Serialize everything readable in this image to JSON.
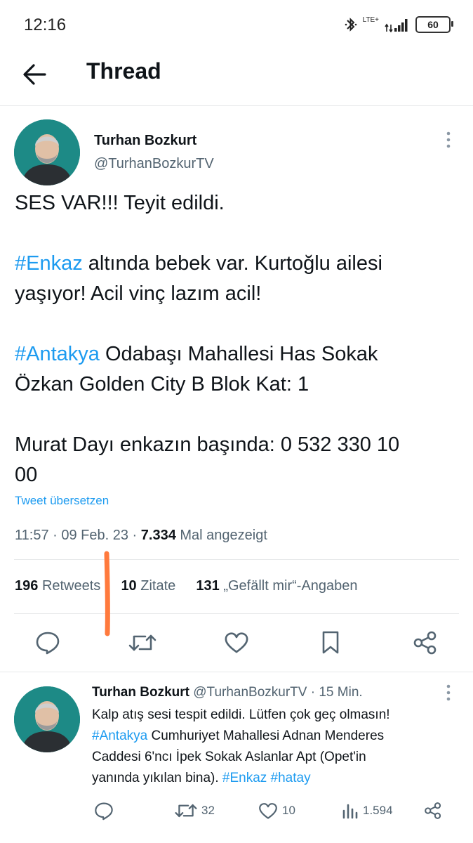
{
  "status_bar": {
    "time": "12:16",
    "network_label": "LTE+",
    "battery_level": "60"
  },
  "nav": {
    "title": "Thread"
  },
  "main_tweet": {
    "author_name": "Turhan Bozkurt",
    "author_handle": "@TurhanBozkurTV",
    "line1": "SES VAR!!! Teyit edildi.",
    "para2_hashtag": "#Enkaz",
    "para2_text_a": " altında bebek var. Kurtoğlu ailesi",
    "para2_text_b": "yaşıyor! Acil vinç lazım acil!",
    "para3_hashtag": "#Antakya",
    "para3_text_a": " Odabaşı Mahallesi Has Sokak",
    "para3_text_b": "Özkan Golden City B Blok Kat: 1",
    "para4_text_a": "Murat Dayı enkazın başında: 0 532 330 10",
    "para4_text_b": "00",
    "translate_label": "Tweet übersetzen",
    "time": "11:57",
    "date": "09 Feb. 23",
    "views_count": "7.334",
    "views_label": "Mal angezeigt",
    "retweets_count": "196",
    "retweets_label": "Retweets",
    "quotes_count": "10",
    "quotes_label": "Zitate",
    "likes_count": "131",
    "likes_label": "„Gefällt mir“-Angaben"
  },
  "reply_tweet": {
    "author_name": "Turhan Bozkurt",
    "author_handle": "@TurhanBozkurTV",
    "time_ago": "15 Min.",
    "text_a": "Kalp atış sesi tespit edildi. Lütfen çok geç olmasın!",
    "hashtag1": "#Antakya",
    "text_b": " Cumhuriyet Mahallesi Adnan Menderes",
    "text_c": "Caddesi 6'ncı İpek Sokak Aslanlar Apt (Opet'in",
    "text_d": "yanında yıkılan bina). ",
    "hashtag2": "#Enkaz",
    "hashtag3": "#hatay",
    "retweet_count": "32",
    "like_count": "10",
    "view_count": "1.594"
  },
  "icons": {
    "back": "arrow-left-icon",
    "more": "more-vertical-icon",
    "reply": "comment-icon",
    "retweet": "retweet-icon",
    "like": "heart-icon",
    "bookmark": "bookmark-icon",
    "share": "share-icon",
    "views": "bar-chart-icon"
  },
  "colors": {
    "accent": "#1d9bf0",
    "text_primary": "#0f1419",
    "text_secondary": "#536471",
    "annotation_mark": "#ff7a3d",
    "avatar_bg": "#1d8a86"
  }
}
